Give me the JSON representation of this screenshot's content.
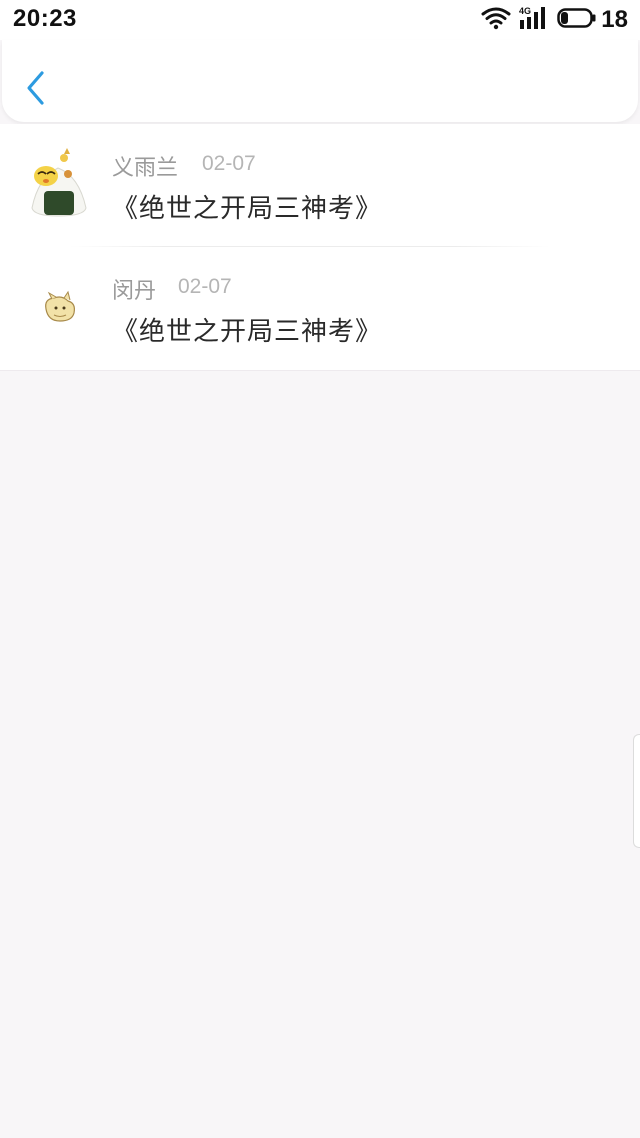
{
  "status_bar": {
    "time": "20:23",
    "network": "4G",
    "battery": "18",
    "icons": [
      "wifi-icon",
      "signal-icon",
      "battery-icon"
    ]
  },
  "header": {
    "back_icon": "chevron-left-icon",
    "accent_color": "#2d9be0"
  },
  "comments": [
    {
      "user": "义雨兰",
      "date": "02-07",
      "book_title": "《绝世之开局三神考》",
      "avatar": "onigiri-chick-avatar"
    },
    {
      "user": "闵丹",
      "date": "02-07",
      "book_title": "《绝世之开局三神考》",
      "avatar": "small-creature-avatar"
    }
  ]
}
